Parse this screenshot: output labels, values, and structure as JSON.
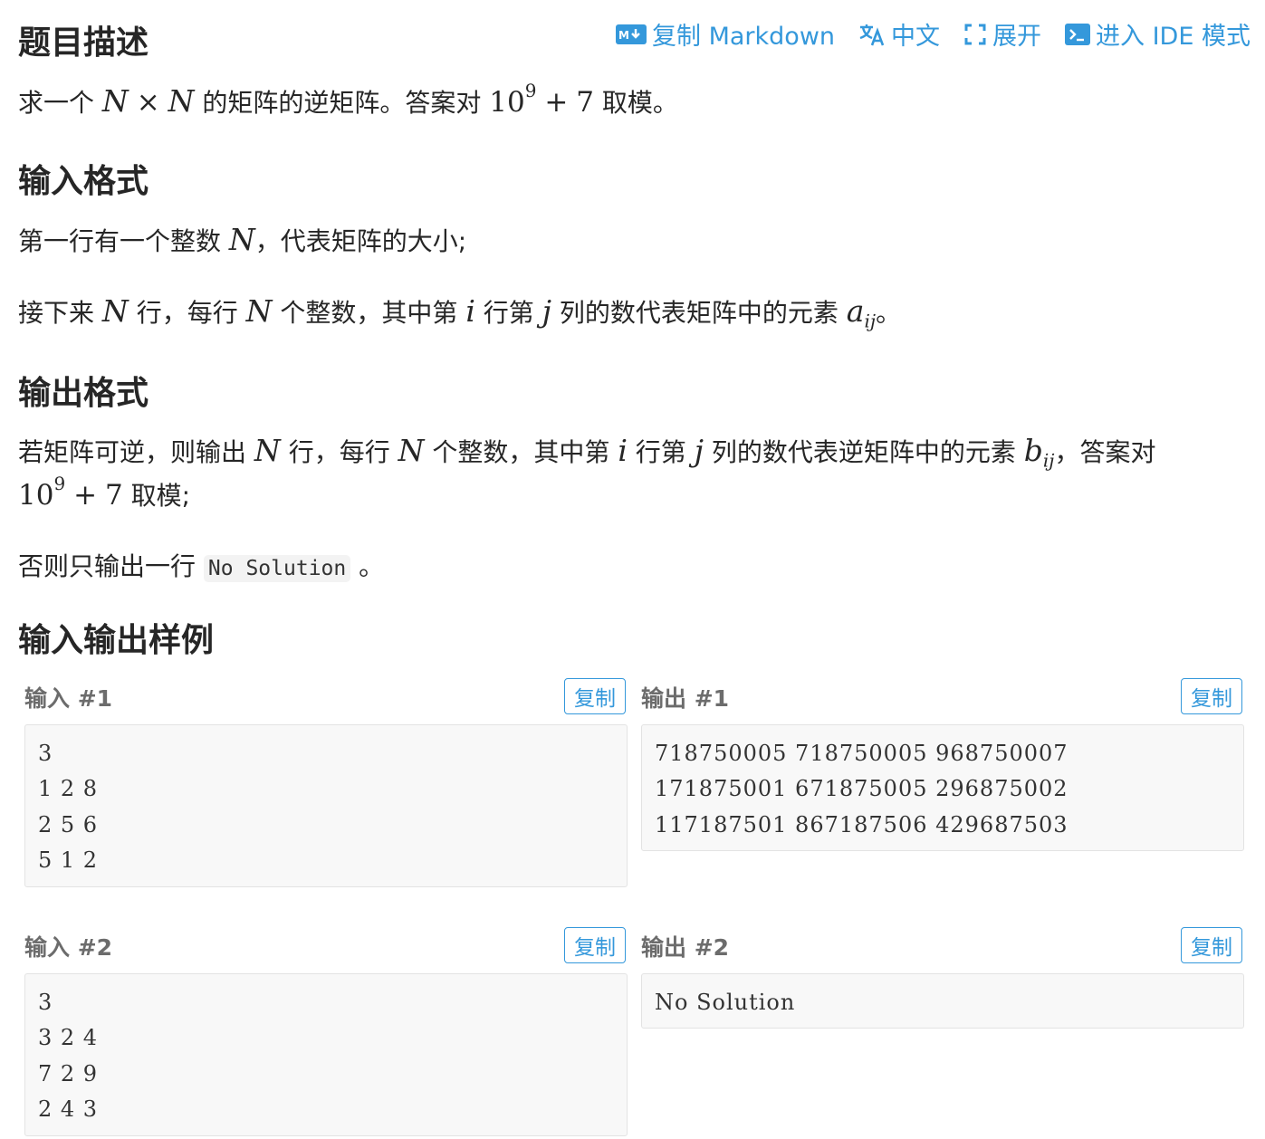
{
  "toolbar": {
    "copy_markdown": "复制 Markdown",
    "chinese": "中文",
    "expand": "展开",
    "enter_ide": "进入 IDE 模式",
    "accent_color": "#3498db"
  },
  "description": {
    "heading": "题目描述",
    "text_a": "求一个",
    "text_b": "的矩阵的逆矩阵。答案对",
    "text_c": "取模。"
  },
  "input_format": {
    "heading": "输入格式",
    "line1_a": "第一行有一个整数",
    "line1_b": "，代表矩阵的大小;",
    "line2_a": "接下来",
    "line2_b": "行，每行",
    "line2_c": "个整数，其中第",
    "line2_d": "行第",
    "line2_e": "列的数代表矩阵中的元素",
    "line2_f": "。"
  },
  "output_format": {
    "heading": "输出格式",
    "line1_a": "若矩阵可逆，则输出",
    "line1_b": "行，每行",
    "line1_c": "个整数，其中第",
    "line1_d": "行第",
    "line1_e": "列的数代表逆矩阵中的元素",
    "line1_f": "，答案对",
    "line2_a": "取模;",
    "line3_a": "否则只输出一行",
    "line3_code": "No Solution",
    "line3_b": "。"
  },
  "math": {
    "N": "N",
    "times": "×",
    "ten": "10",
    "nine": "9",
    "plus": "+",
    "seven": "7",
    "i": "i",
    "j": "j",
    "a": "a",
    "b": "b",
    "ij": "ij"
  },
  "samples": {
    "heading": "输入输出样例",
    "copy_label": "复制",
    "items": [
      {
        "input_label": "输入 #1",
        "output_label": "输出 #1",
        "input_lines": [
          "3",
          "1 2 8",
          "2 5 6",
          "5 1 2"
        ],
        "output_lines": [
          "718750005 718750005 968750007",
          "171875001 671875005 296875002",
          "117187501 867187506 429687503"
        ]
      },
      {
        "input_label": "输入 #2",
        "output_label": "输出 #2",
        "input_lines": [
          "3",
          "3 2 4",
          "7 2 9",
          "2 4 3"
        ],
        "output_lines": [
          "No Solution"
        ]
      }
    ]
  }
}
